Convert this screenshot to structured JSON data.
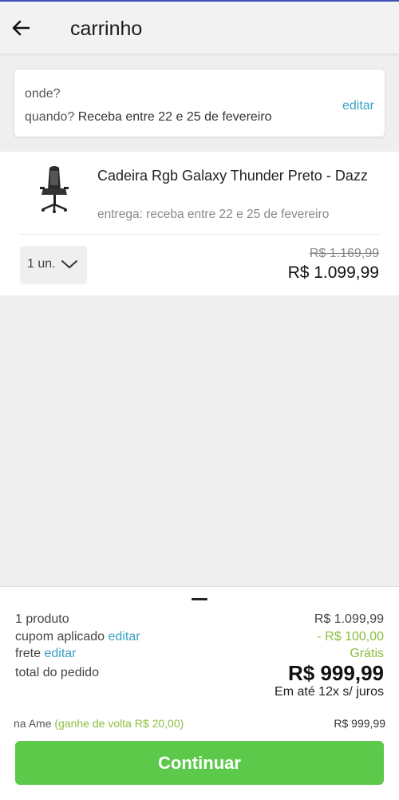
{
  "header": {
    "title": "carrinho"
  },
  "where_box": {
    "where_label": "onde?",
    "when_label": "quando?",
    "when_value": "Receba entre 22 e 25 de fevereiro",
    "edit_label": "editar"
  },
  "product": {
    "name": "Cadeira Rgb Galaxy Thunder Preto - Dazz",
    "delivery": "entrega: receba entre 22 e 25 de fevereiro",
    "quantity": "1 un.",
    "old_price": "R$ 1.169,99",
    "price": "R$ 1.099,99"
  },
  "summary": {
    "products_label": "1 produto",
    "products_value": "R$ 1.099,99",
    "coupon_label": "cupom aplicado",
    "coupon_edit": "editar",
    "coupon_value": "- R$ 100,00",
    "shipping_label": "frete",
    "shipping_edit": "editar",
    "shipping_value": "Grátis",
    "total_label": "total do pedido",
    "total_value": "R$ 999,99",
    "installments": "Em até 12x s/ juros",
    "ame_label": "na Ame",
    "ame_cashback": "(ganhe de volta R$ 20,00)",
    "ame_price": "R$ 999,99",
    "continue_label": "Continuar"
  },
  "colors": {
    "accent": "#3aa1c8",
    "success": "#5cc94a",
    "cashback": "#8bbf3f"
  }
}
